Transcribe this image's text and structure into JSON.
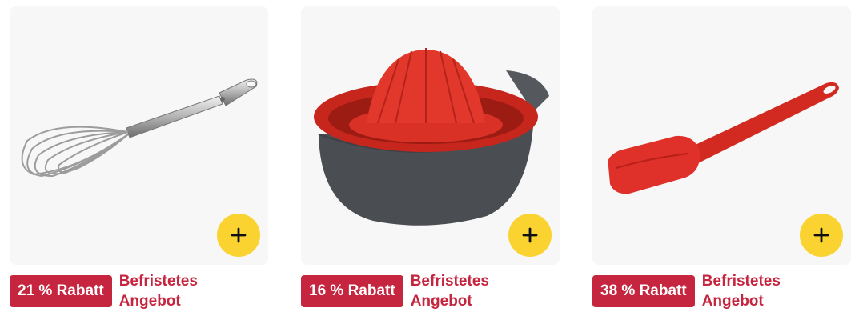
{
  "products": [
    {
      "image_alt": "Whisk",
      "add_icon": "plus-icon",
      "discount_badge": "21 % Rabatt",
      "deal_label": "Befristetes Angebot"
    },
    {
      "image_alt": "Citrus juicer",
      "add_icon": "plus-icon",
      "discount_badge": "16 % Rabatt",
      "deal_label": "Befristetes Angebot"
    },
    {
      "image_alt": "Spatula",
      "add_icon": "plus-icon",
      "discount_badge": "38 % Rabatt",
      "deal_label": "Befristetes Angebot"
    }
  ],
  "colors": {
    "badge_bg": "#c6253f",
    "deal_text": "#c6253f",
    "add_button": "#fad331",
    "card_bg": "#f7f7f7"
  }
}
